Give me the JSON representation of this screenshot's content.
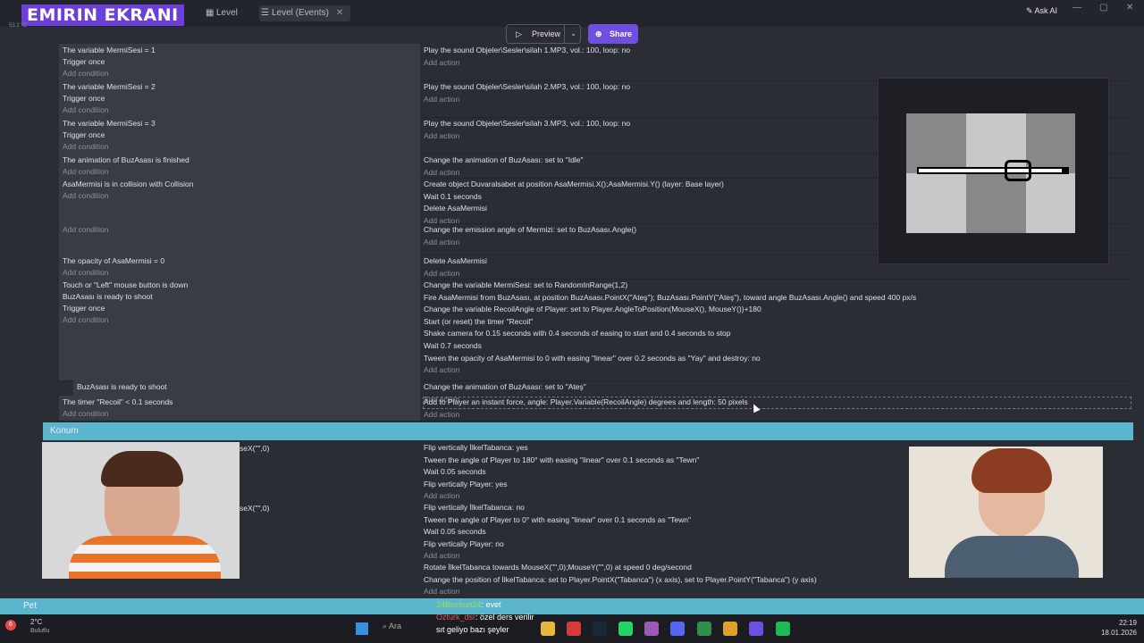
{
  "stream": {
    "logo": "EMIRIN EKRANI",
    "temp": "53.2 °C"
  },
  "tabs": [
    {
      "label": "Level"
    },
    {
      "label": "Level (Events)"
    }
  ],
  "header": {
    "ask_ai": "Ask AI",
    "preview": "Preview",
    "share": "Share"
  },
  "events": [
    {
      "c": [
        "The variable  MermiSesi = 1",
        "Trigger once",
        "Add condition"
      ],
      "a": [
        "Play the sound Objeler\\Sesler\\silah 1.MP3, vol.: 100, loop: no",
        "Add action"
      ]
    },
    {
      "c": [
        "The variable  MermiSesi = 2",
        "Trigger once",
        "Add condition"
      ],
      "a": [
        "Play the sound Objeler\\Sesler\\silah 2.MP3, vol.: 100, loop: no",
        "Add action"
      ]
    },
    {
      "c": [
        "The variable  MermiSesi = 3",
        "Trigger once",
        "Add condition"
      ],
      "a": [
        "Play the sound Objeler\\Sesler\\silah 3.MP3, vol.: 100, loop: no",
        "Add action"
      ]
    },
    {
      "c": [
        "The animation of  BuzAsası is finished",
        "Add condition"
      ],
      "a": [
        "Change the animation of  BuzAsası: set to \"Idle\"",
        "Add action"
      ]
    },
    {
      "c": [
        "AsaMermisi is in collision with  Collision",
        "Add condition"
      ],
      "a": [
        "Create object  Duvaralsabet at position AsaMermisi.X();AsaMermisi.Y() (layer: Base layer)",
        "Wait 0.1 seconds",
        "Delete  AsaMermisi",
        "Add action"
      ]
    },
    {
      "c": [
        "Add condition"
      ],
      "a": [
        "Change the emission angle of  Mermizi: set to BuzAsası.Angle()",
        "Add action"
      ]
    },
    {
      "c": [
        "The opacity of  AsaMermisi = 0",
        "Add condition"
      ],
      "a": [
        "Delete  AsaMermisi",
        "Add action"
      ]
    },
    {
      "c": [
        "Touch or \"Left\" mouse button is down",
        "BuzAsası is ready to shoot",
        "Trigger once",
        "Add condition"
      ],
      "a": [
        "Change the variable  MermiSesi: set to RandomInRange(1,2)",
        "Fire  AsaMermisi from  BuzAsası, at position BuzAsası.PointX(\"Ateş\"); BuzAsası.PointY(\"Ateş\"), toward angle BuzAsası.Angle() and speed 400 px/s",
        "Change the variable  RecoilAngle of  Player: set to Player.AngleToPosition(MouseX(), MouseY())+180",
        "Start (or reset) the timer \"Recoil\"",
        "Shake camera for 0.15 seconds with 0.4 seconds of easing to start and 0.4 seconds to stop",
        "Wait 0.7 seconds",
        "Tween the opacity of  AsaMermisi to 0 with easing \"linear\" over 0.2 seconds as \"Yay\" and destroy: no",
        "Add action"
      ]
    },
    {
      "c": [
        "BuzAsası is ready to shoot",
        "Add condition"
      ],
      "a": [
        "Change the animation of  BuzAsası: set to \"Ateş\"",
        "Add action"
      ]
    },
    {
      "c": [
        "The timer \"Recoil\" < 0.1 seconds",
        "Add condition"
      ],
      "a": [
        "Add to  Player an instant force, angle: Player.Variable(RecoilAngle) degrees and length: 50 pixels",
        "Add action"
      ]
    }
  ],
  "group1": "Konum",
  "konum": {
    "a1": [
      "Flip vertically  İlkelTabanca: yes",
      "Tween the angle of  Player to 180° with easing \"linear\" over 0.1 seconds as \"Tewn\"",
      "Wait 0.05 seconds",
      "Flip vertically  Player: yes",
      "Add action"
    ],
    "a2": [
      "Flip vertically  İlkelTabanca: no",
      "Tween the angle of  Player to 0° with easing \"linear\" over 0.1 seconds as \"Tewn\"",
      "Wait 0.05 seconds",
      "Flip vertically  Player: no",
      "Add action"
    ],
    "a3": [
      "Rotate  İlkelTabanca towards MouseX(\"\",0);MouseY(\"\",0) at speed 0 deg/second",
      "Change the position of  İlkelTabanca: set to Player.PointX(\"Tabanca\") (x axis), set to Player.PointY(\"Tabanca\") (y axis)",
      "Add action"
    ],
    "c1": "seX(\"\",0)",
    "c2": "seX(\"\",0)"
  },
  "group2": "Pet",
  "chat": [
    {
      "user": "34Bozkurt34",
      "msg": ": evet"
    },
    {
      "user": "Ozturk_dsr",
      "msg": ": özel ders verilir"
    },
    {
      "user": "",
      "msg": "sıt geliyo bazı şeyler"
    }
  ],
  "taskbar": {
    "search": "Ara",
    "weather": "2°C",
    "weather_sub": "Bulutlu",
    "time": "22:19",
    "date": "18.01.2026",
    "badge": "6"
  }
}
